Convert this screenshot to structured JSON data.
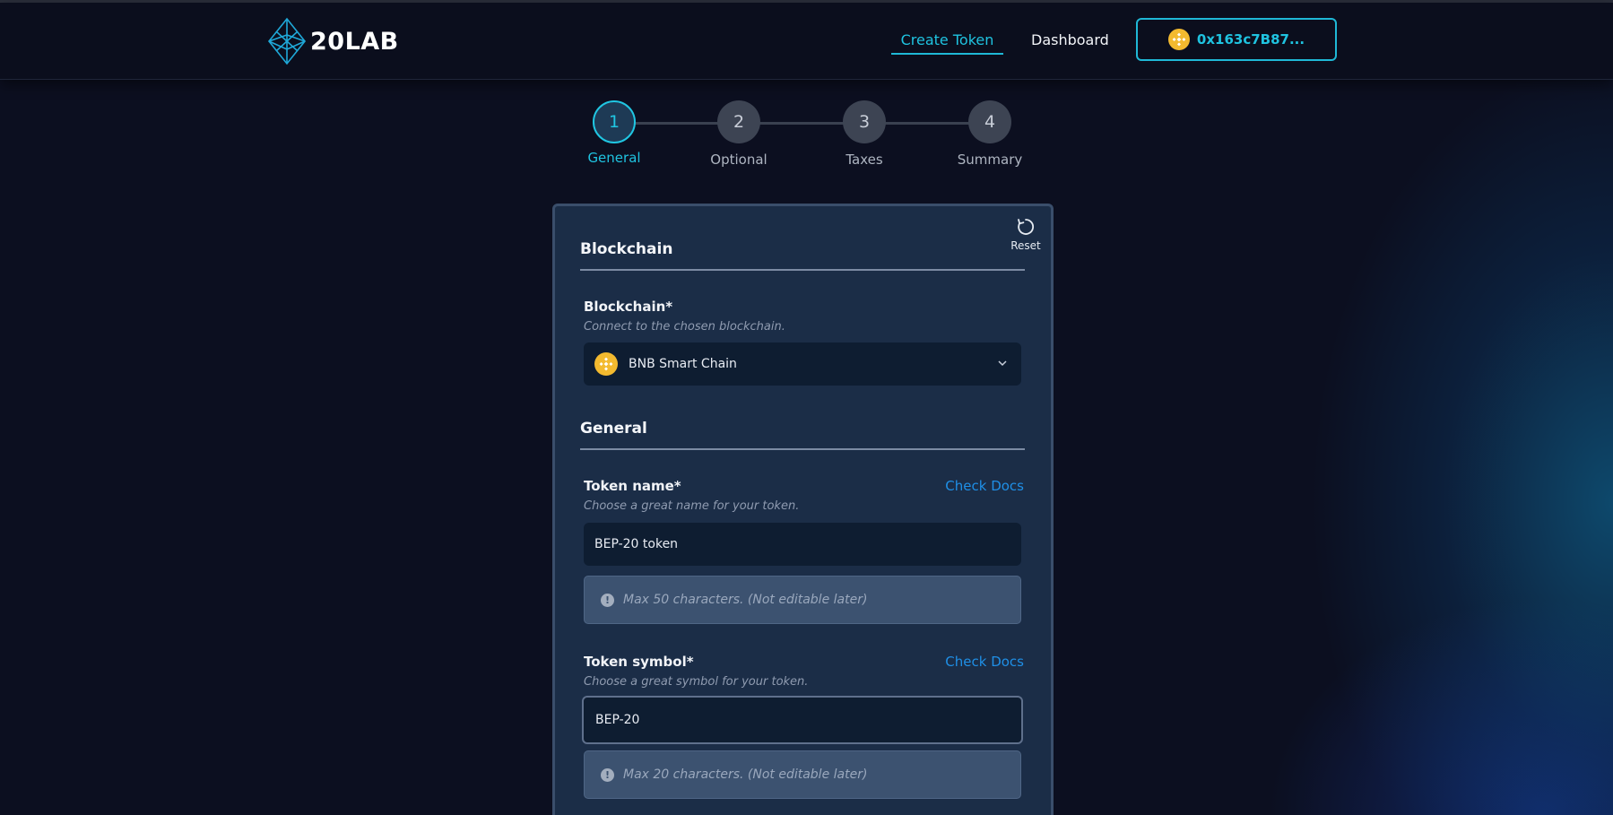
{
  "header": {
    "logo_text": "20LAB",
    "nav": {
      "create_token": "Create Token",
      "dashboard": "Dashboard"
    },
    "wallet_address": "0x163c7B87..."
  },
  "stepper": {
    "steps": [
      {
        "number": "1",
        "label": "General",
        "active": true
      },
      {
        "number": "2",
        "label": "Optional",
        "active": false
      },
      {
        "number": "3",
        "label": "Taxes",
        "active": false
      },
      {
        "number": "4",
        "label": "Summary",
        "active": false
      }
    ]
  },
  "form": {
    "reset_label": "Reset",
    "blockchain_section": {
      "title": "Blockchain",
      "field_label": "Blockchain*",
      "help": "Connect to the chosen blockchain.",
      "selected_value": "BNB Smart Chain",
      "selected_icon": "bnb-icon"
    },
    "general_section": {
      "title": "General",
      "token_name": {
        "label": "Token name*",
        "help": "Choose a great name for your token.",
        "value": "BEP-20 token",
        "docs_link": "Check Docs",
        "note": "Max 50 characters. (Not editable later)"
      },
      "token_symbol": {
        "label": "Token symbol*",
        "help": "Choose a great symbol for your token.",
        "value": "BEP-20",
        "docs_link": "Check Docs",
        "note": "Max 20 characters. (Not editable later)"
      }
    }
  },
  "colors": {
    "accent": "#1fc3e0",
    "link": "#1f8fe6",
    "card_bg": "#1b2d47",
    "page_bg": "#0c0f20",
    "bnb_yellow": "#f3ba2f"
  }
}
